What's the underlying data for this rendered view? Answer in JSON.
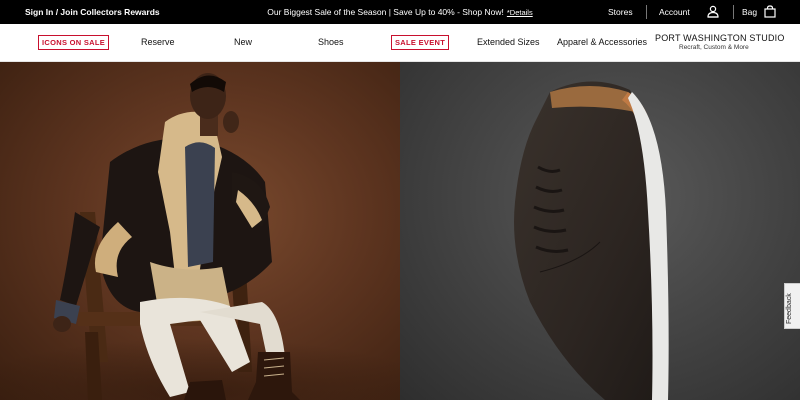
{
  "topbar": {
    "signin": "Sign In / Join Collectors Rewards",
    "promo": "Our Biggest Sale of the Season | Save Up to 40% - Shop Now!",
    "details": "*Details",
    "stores": "Stores",
    "account": "Account",
    "bag": "Bag",
    "icons": {
      "account": "user-icon",
      "bag": "shopping-bag-icon"
    }
  },
  "nav": {
    "icons_on_sale": "ICONS ON SALE",
    "reserve": "Reserve",
    "new": "New",
    "shoes": "Shoes",
    "sale_event": "SALE EVENT",
    "extended_sizes": "Extended Sizes",
    "apparel": "Apparel & Accessories",
    "studio_title": "PORT WASHINGTON STUDIO",
    "studio_sub": "Recraft, Custom & More",
    "sale_color": "#c8102e"
  },
  "feedback": {
    "label": "Feedback"
  }
}
